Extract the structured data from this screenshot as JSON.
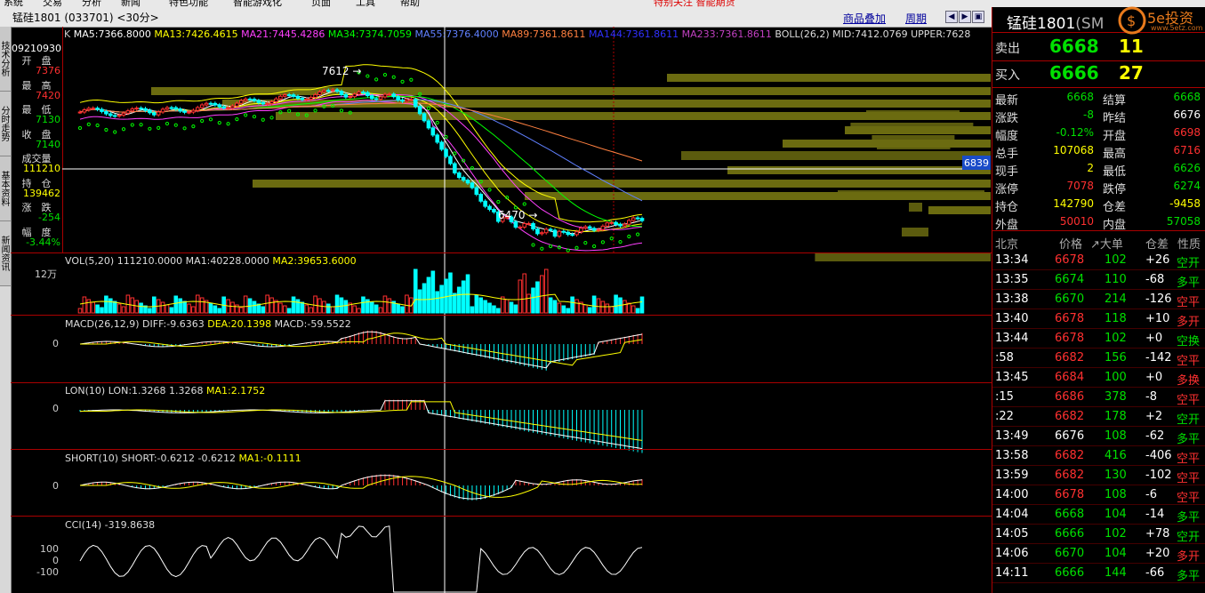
{
  "menu": [
    "系统",
    "交易",
    "分析",
    "新闻",
    "特色功能",
    "智能游戏化",
    "页面",
    "工具",
    "帮助"
  ],
  "slogan": "特别关注 智能期货",
  "window": {
    "title": "锰硅1801 (033701) <30分>",
    "links": [
      "商品叠加",
      "周期"
    ]
  },
  "side_tabs": [
    "技术分析",
    "分时走势",
    "基本资料",
    "新闻资讯"
  ],
  "left_info": {
    "date": "09210930",
    "items": [
      {
        "label": "开　盘",
        "value": "7376",
        "color": "#ff3030"
      },
      {
        "label": "最　高",
        "value": "7420",
        "color": "#ff3030"
      },
      {
        "label": "最　低",
        "value": "7130",
        "color": "#00e000"
      },
      {
        "label": "收　盘",
        "value": "7140",
        "color": "#00e000"
      },
      {
        "label": "成交量",
        "value": "111210",
        "color": "#ffff00"
      },
      {
        "label": "持　仓",
        "value": "139462",
        "color": "#ffff00"
      },
      {
        "label": "涨　跌",
        "value": "-254",
        "color": "#00e000"
      },
      {
        "label": "幅　度",
        "value": "-3.44%",
        "color": "#00e000"
      }
    ]
  },
  "main_chart": {
    "ma_labels": [
      {
        "text": "K",
        "color": "#cccccc"
      },
      {
        "text": "MA5:7366.8000",
        "color": "#ffffff"
      },
      {
        "text": "MA13:7426.4615",
        "color": "#ffff00"
      },
      {
        "text": "MA21:7445.4286",
        "color": "#ff40ff"
      },
      {
        "text": "MA34:7374.7059",
        "color": "#00ff00"
      },
      {
        "text": "MA55:7376.4000",
        "color": "#6080ff"
      },
      {
        "text": "MA89:7361.8611",
        "color": "#ff8040"
      },
      {
        "text": "MA144:7361.8611",
        "color": "#3030ff"
      },
      {
        "text": "MA233:7361.8611",
        "color": "#c040c0"
      },
      {
        "text": "BOLL(26,2) MID:7412.0769 UPPER:7628",
        "color": "#dddddd"
      }
    ],
    "high_label": "7612",
    "low_label": "6470",
    "cursor_price": "6839"
  },
  "indicators": {
    "vol": {
      "label": "VOL(5,20) 111210.0000",
      "ma1": "MA1:40228.0000",
      "ma2": "MA2:39653.6000",
      "axis": "12万"
    },
    "macd": {
      "label": "MACD(26,12,9) DIFF:-9.6363",
      "dea": "DEA:20.1398",
      "macd": "MACD:-59.5522",
      "axis": "0"
    },
    "lon": {
      "label": "LON(10) LON:1.3268 1.3268",
      "ma1": "MA1:2.1752",
      "axis": "0"
    },
    "short": {
      "label": "SHORT(10) SHORT:-0.6212 -0.6212",
      "ma1": "MA1:-0.1111",
      "axis": "0"
    },
    "cci": {
      "label": "CCI(14) -319.8638",
      "axis": [
        "100",
        "0",
        "-100"
      ]
    }
  },
  "right_panel": {
    "name": "锰硅1801",
    "name_extra": "(SM",
    "logo_text": "5e投资",
    "logo_url": "www.5etz.com",
    "sell": {
      "label": "卖出",
      "price": "6668",
      "vol": "11"
    },
    "buy": {
      "label": "买入",
      "price": "6666",
      "vol": "27"
    },
    "quotes": [
      {
        "l": "最新",
        "v": "6668",
        "c": "#00e000",
        "l2": "结算",
        "v2": "6668",
        "c2": "#00e000"
      },
      {
        "l": "涨跌",
        "v": "-8",
        "c": "#00e000",
        "l2": "昨结",
        "v2": "6676",
        "c2": "#ffffff"
      },
      {
        "l": "幅度",
        "v": "-0.12%",
        "c": "#00e000",
        "l2": "开盘",
        "v2": "6698",
        "c2": "#ff3030"
      },
      {
        "l": "总手",
        "v": "107068",
        "c": "#ffff00",
        "l2": "最高",
        "v2": "6716",
        "c2": "#ff3030"
      },
      {
        "l": "现手",
        "v": "2",
        "c": "#ffff00",
        "l2": "最低",
        "v2": "6626",
        "c2": "#00e000"
      },
      {
        "l": "涨停",
        "v": "7078",
        "c": "#ff3030",
        "l2": "跌停",
        "v2": "6274",
        "c2": "#00e000"
      },
      {
        "l": "持仓",
        "v": "142790",
        "c": "#ffff00",
        "l2": "仓差",
        "v2": "-9458",
        "c2": "#ffff00"
      },
      {
        "l": "外盘",
        "v": "50010",
        "c": "#ff3030",
        "l2": "内盘",
        "v2": "57058",
        "c2": "#00e000"
      }
    ],
    "trade_header": [
      "北京",
      "价格",
      "↗大单",
      "仓差",
      "性质"
    ],
    "trades": [
      {
        "t": "13:34",
        "p": "6678",
        "pc": "#ff3030",
        "v": "102",
        "d": "+26",
        "n": "空开",
        "nc": "#00e000"
      },
      {
        "t": "13:35",
        "p": "6674",
        "pc": "#00e000",
        "v": "110",
        "d": "-68",
        "n": "多平",
        "nc": "#00e000"
      },
      {
        "t": "13:38",
        "p": "6670",
        "pc": "#00e000",
        "v": "214",
        "d": "-126",
        "n": "空平",
        "nc": "#ff3030"
      },
      {
        "t": "13:40",
        "p": "6678",
        "pc": "#ff3030",
        "v": "118",
        "d": "+10",
        "n": "多开",
        "nc": "#ff3030"
      },
      {
        "t": "13:44",
        "p": "6678",
        "pc": "#ff3030",
        "v": "102",
        "d": "+0",
        "n": "空换",
        "nc": "#00e000"
      },
      {
        "t": ":58",
        "p": "6682",
        "pc": "#ff3030",
        "v": "156",
        "d": "-142",
        "n": "空平",
        "nc": "#ff3030"
      },
      {
        "t": "13:45",
        "p": "6684",
        "pc": "#ff3030",
        "v": "100",
        "d": "+0",
        "n": "多换",
        "nc": "#ff3030"
      },
      {
        "t": ":15",
        "p": "6686",
        "pc": "#ff3030",
        "v": "378",
        "d": "-8",
        "n": "空平",
        "nc": "#ff3030"
      },
      {
        "t": ":22",
        "p": "6682",
        "pc": "#ff3030",
        "v": "178",
        "d": "+2",
        "n": "空开",
        "nc": "#00e000"
      },
      {
        "t": "13:49",
        "p": "6676",
        "pc": "#ffffff",
        "v": "108",
        "d": "-62",
        "n": "多平",
        "nc": "#00e000"
      },
      {
        "t": "13:58",
        "p": "6682",
        "pc": "#ff3030",
        "v": "416",
        "d": "-406",
        "n": "空平",
        "nc": "#ff3030"
      },
      {
        "t": "13:59",
        "p": "6682",
        "pc": "#ff3030",
        "v": "130",
        "d": "-102",
        "n": "空平",
        "nc": "#ff3030"
      },
      {
        "t": "14:00",
        "p": "6678",
        "pc": "#ff3030",
        "v": "108",
        "d": "-6",
        "n": "空平",
        "nc": "#ff3030"
      },
      {
        "t": "14:04",
        "p": "6668",
        "pc": "#00e000",
        "v": "104",
        "d": "-14",
        "n": "多平",
        "nc": "#00e000"
      },
      {
        "t": "14:05",
        "p": "6666",
        "pc": "#00e000",
        "v": "102",
        "d": "+78",
        "n": "空开",
        "nc": "#00e000"
      },
      {
        "t": "14:06",
        "p": "6670",
        "pc": "#00e000",
        "v": "104",
        "d": "+20",
        "n": "多开",
        "nc": "#ff3030"
      },
      {
        "t": "14:11",
        "p": "6666",
        "pc": "#00e000",
        "v": "144",
        "d": "-66",
        "n": "多平",
        "nc": "#00e000"
      }
    ]
  }
}
